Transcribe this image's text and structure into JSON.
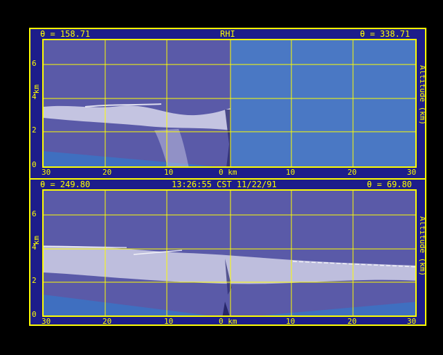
{
  "colors": {
    "frame": "#ffff00",
    "panel_bg": "#1d1d8a",
    "sky_left": "#5a5aa8",
    "sky_right": "#4a78c4",
    "ground": "#3f6fc0",
    "cloud": "#ffffff"
  },
  "top": {
    "left_label": "θ = 158.71",
    "center_label": "RHI",
    "right_label": "θ = 338.71",
    "y_axis_label": "km",
    "y_axis_right": "Altitude (km)",
    "y_ticks": [
      "0",
      "2",
      "4",
      "6"
    ],
    "x_ticks": [
      "30",
      "20",
      "10",
      "0 km",
      "10",
      "20",
      "30"
    ]
  },
  "bottom": {
    "left_label": "θ = 249.80",
    "center_label": "13:26:55 CST 11/22/91",
    "right_label": "θ = 69.80",
    "y_axis_label": "km",
    "y_axis_right": "Altitude (km)",
    "y_ticks": [
      "0",
      "2",
      "4",
      "6"
    ],
    "x_ticks": [
      "30",
      "20",
      "10",
      "0 km",
      "10",
      "20",
      "30"
    ]
  }
}
